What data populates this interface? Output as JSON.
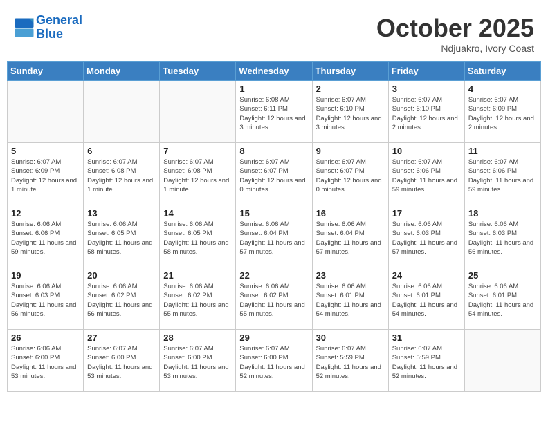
{
  "header": {
    "logo_line1": "General",
    "logo_line2": "Blue",
    "month": "October 2025",
    "location": "Ndjuakro, Ivory Coast"
  },
  "weekdays": [
    "Sunday",
    "Monday",
    "Tuesday",
    "Wednesday",
    "Thursday",
    "Friday",
    "Saturday"
  ],
  "weeks": [
    [
      {
        "day": "",
        "info": ""
      },
      {
        "day": "",
        "info": ""
      },
      {
        "day": "",
        "info": ""
      },
      {
        "day": "1",
        "info": "Sunrise: 6:08 AM\nSunset: 6:11 PM\nDaylight: 12 hours\nand 3 minutes."
      },
      {
        "day": "2",
        "info": "Sunrise: 6:07 AM\nSunset: 6:10 PM\nDaylight: 12 hours\nand 3 minutes."
      },
      {
        "day": "3",
        "info": "Sunrise: 6:07 AM\nSunset: 6:10 PM\nDaylight: 12 hours\nand 2 minutes."
      },
      {
        "day": "4",
        "info": "Sunrise: 6:07 AM\nSunset: 6:09 PM\nDaylight: 12 hours\nand 2 minutes."
      }
    ],
    [
      {
        "day": "5",
        "info": "Sunrise: 6:07 AM\nSunset: 6:09 PM\nDaylight: 12 hours\nand 1 minute."
      },
      {
        "day": "6",
        "info": "Sunrise: 6:07 AM\nSunset: 6:08 PM\nDaylight: 12 hours\nand 1 minute."
      },
      {
        "day": "7",
        "info": "Sunrise: 6:07 AM\nSunset: 6:08 PM\nDaylight: 12 hours\nand 1 minute."
      },
      {
        "day": "8",
        "info": "Sunrise: 6:07 AM\nSunset: 6:07 PM\nDaylight: 12 hours\nand 0 minutes."
      },
      {
        "day": "9",
        "info": "Sunrise: 6:07 AM\nSunset: 6:07 PM\nDaylight: 12 hours\nand 0 minutes."
      },
      {
        "day": "10",
        "info": "Sunrise: 6:07 AM\nSunset: 6:06 PM\nDaylight: 11 hours\nand 59 minutes."
      },
      {
        "day": "11",
        "info": "Sunrise: 6:07 AM\nSunset: 6:06 PM\nDaylight: 11 hours\nand 59 minutes."
      }
    ],
    [
      {
        "day": "12",
        "info": "Sunrise: 6:06 AM\nSunset: 6:06 PM\nDaylight: 11 hours\nand 59 minutes."
      },
      {
        "day": "13",
        "info": "Sunrise: 6:06 AM\nSunset: 6:05 PM\nDaylight: 11 hours\nand 58 minutes."
      },
      {
        "day": "14",
        "info": "Sunrise: 6:06 AM\nSunset: 6:05 PM\nDaylight: 11 hours\nand 58 minutes."
      },
      {
        "day": "15",
        "info": "Sunrise: 6:06 AM\nSunset: 6:04 PM\nDaylight: 11 hours\nand 57 minutes."
      },
      {
        "day": "16",
        "info": "Sunrise: 6:06 AM\nSunset: 6:04 PM\nDaylight: 11 hours\nand 57 minutes."
      },
      {
        "day": "17",
        "info": "Sunrise: 6:06 AM\nSunset: 6:03 PM\nDaylight: 11 hours\nand 57 minutes."
      },
      {
        "day": "18",
        "info": "Sunrise: 6:06 AM\nSunset: 6:03 PM\nDaylight: 11 hours\nand 56 minutes."
      }
    ],
    [
      {
        "day": "19",
        "info": "Sunrise: 6:06 AM\nSunset: 6:03 PM\nDaylight: 11 hours\nand 56 minutes."
      },
      {
        "day": "20",
        "info": "Sunrise: 6:06 AM\nSunset: 6:02 PM\nDaylight: 11 hours\nand 56 minutes."
      },
      {
        "day": "21",
        "info": "Sunrise: 6:06 AM\nSunset: 6:02 PM\nDaylight: 11 hours\nand 55 minutes."
      },
      {
        "day": "22",
        "info": "Sunrise: 6:06 AM\nSunset: 6:02 PM\nDaylight: 11 hours\nand 55 minutes."
      },
      {
        "day": "23",
        "info": "Sunrise: 6:06 AM\nSunset: 6:01 PM\nDaylight: 11 hours\nand 54 minutes."
      },
      {
        "day": "24",
        "info": "Sunrise: 6:06 AM\nSunset: 6:01 PM\nDaylight: 11 hours\nand 54 minutes."
      },
      {
        "day": "25",
        "info": "Sunrise: 6:06 AM\nSunset: 6:01 PM\nDaylight: 11 hours\nand 54 minutes."
      }
    ],
    [
      {
        "day": "26",
        "info": "Sunrise: 6:06 AM\nSunset: 6:00 PM\nDaylight: 11 hours\nand 53 minutes."
      },
      {
        "day": "27",
        "info": "Sunrise: 6:07 AM\nSunset: 6:00 PM\nDaylight: 11 hours\nand 53 minutes."
      },
      {
        "day": "28",
        "info": "Sunrise: 6:07 AM\nSunset: 6:00 PM\nDaylight: 11 hours\nand 53 minutes."
      },
      {
        "day": "29",
        "info": "Sunrise: 6:07 AM\nSunset: 6:00 PM\nDaylight: 11 hours\nand 52 minutes."
      },
      {
        "day": "30",
        "info": "Sunrise: 6:07 AM\nSunset: 5:59 PM\nDaylight: 11 hours\nand 52 minutes."
      },
      {
        "day": "31",
        "info": "Sunrise: 6:07 AM\nSunset: 5:59 PM\nDaylight: 11 hours\nand 52 minutes."
      },
      {
        "day": "",
        "info": ""
      }
    ]
  ]
}
